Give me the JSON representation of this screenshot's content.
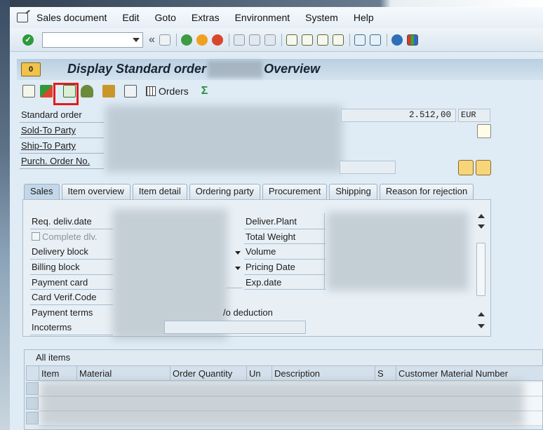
{
  "menu": {
    "items": [
      "Sales document",
      "Edit",
      "Goto",
      "Extras",
      "Environment",
      "System",
      "Help"
    ]
  },
  "system_toolbar": {
    "command_field_value": "",
    "back_glyph": "«"
  },
  "title": {
    "prefix": "Display Standard order",
    "suffix": "Overview",
    "badge": "0"
  },
  "app_toolbar": {
    "orders_label": "Orders"
  },
  "header": {
    "standard_order_label": "Standard order",
    "sold_to_label": "Sold-To Party",
    "ship_to_label": "Ship-To Party",
    "po_label": "Purch. Order No.",
    "net_value": "2.512,00",
    "currency": "EUR"
  },
  "tabs": [
    "Sales",
    "Item overview",
    "Item detail",
    "Ordering party",
    "Procurement",
    "Shipping",
    "Reason for rejection"
  ],
  "sales_tab": {
    "left_labels": {
      "req_deliv_date": "Req. deliv.date",
      "complete_dlv": "Complete dlv.",
      "delivery_block": "Delivery block",
      "billing_block": "Billing block",
      "payment_card": "Payment card",
      "card_verif_code": "Card Verif.Code",
      "payment_terms": "Payment terms",
      "incoterms": "Incoterms"
    },
    "right_labels": {
      "deliver_plant": "Deliver.Plant",
      "total_weight": "Total Weight",
      "volume": "Volume",
      "pricing_date": "Pricing Date",
      "exp_date": "Exp.date"
    },
    "payment_terms_text": "/o deduction"
  },
  "items": {
    "title": "All items",
    "columns": [
      "Item",
      "Material",
      "Order Quantity",
      "Un",
      "Description",
      "S",
      "Customer Material Number"
    ]
  },
  "colors": {
    "highlight": "#e01d1d",
    "title_bar": "#c3d7e8"
  }
}
